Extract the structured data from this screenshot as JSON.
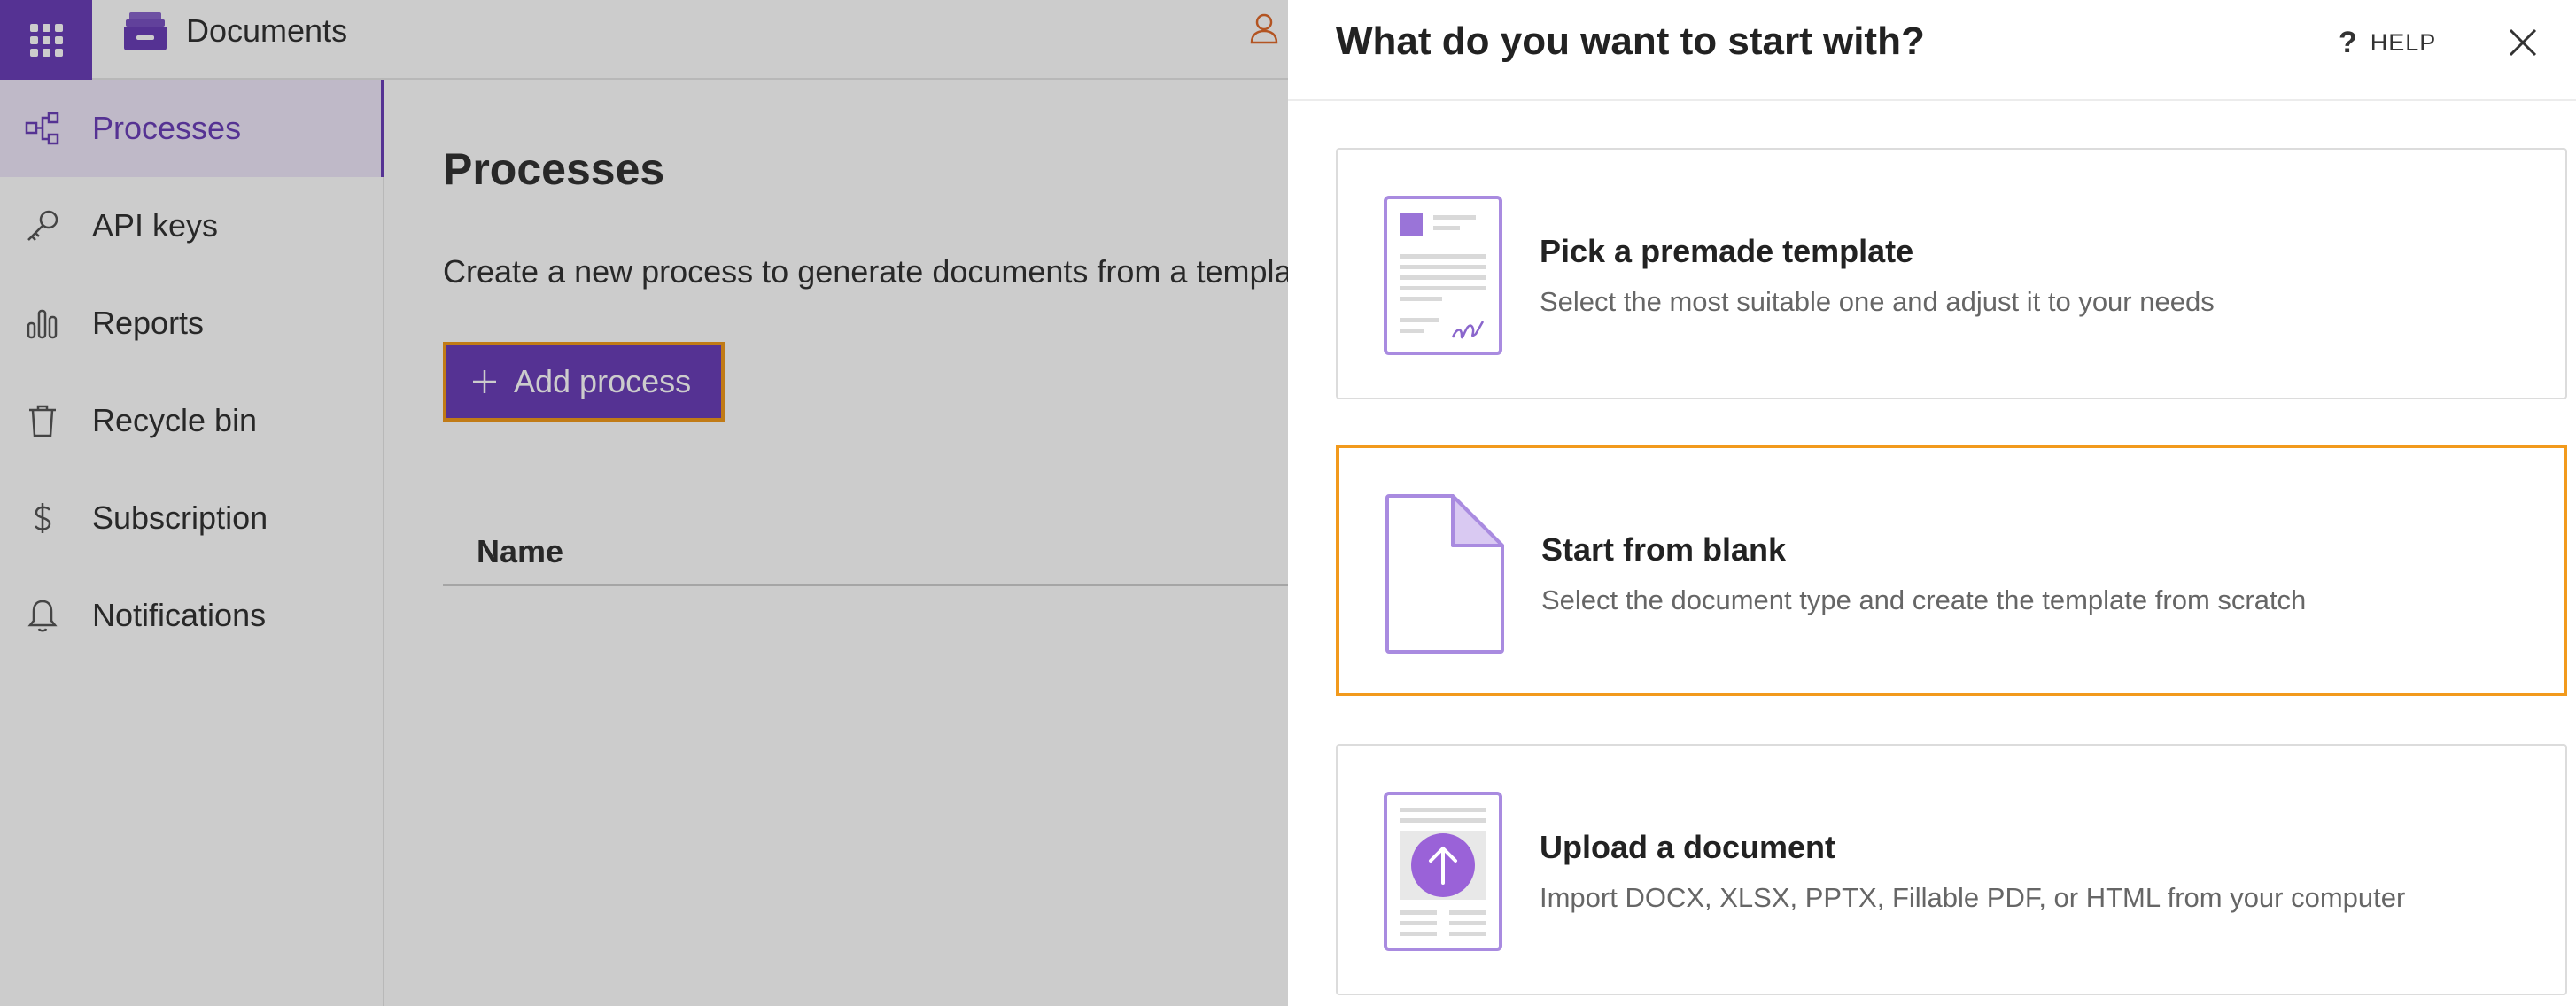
{
  "app": {
    "title": "Documents"
  },
  "sidebar": {
    "items": [
      {
        "label": "Processes",
        "icon": "flow-icon",
        "active": true
      },
      {
        "label": "API keys",
        "icon": "key-icon",
        "active": false
      },
      {
        "label": "Reports",
        "icon": "bar-chart-icon",
        "active": false
      },
      {
        "label": "Recycle bin",
        "icon": "trash-icon",
        "active": false
      },
      {
        "label": "Subscription",
        "icon": "dollar-icon",
        "active": false
      },
      {
        "label": "Notifications",
        "icon": "bell-icon",
        "active": false
      }
    ]
  },
  "main": {
    "title": "Processes",
    "description": "Create a new process to generate documents from a templa",
    "add_button": "Add process",
    "table": {
      "columns": [
        "Name"
      ]
    }
  },
  "drawer": {
    "title": "What do you want to start with?",
    "help": "HELP",
    "options": [
      {
        "title": "Pick a premade template",
        "description": "Select the most suitable one and adjust it to your needs",
        "icon": "template-document-icon",
        "selected": false
      },
      {
        "title": "Start from blank",
        "description": "Select the document type and create the template from scratch",
        "icon": "blank-document-icon",
        "selected": true
      },
      {
        "title": "Upload a document",
        "description": "Import DOCX, XLSX, PPTX, Fillable PDF, or HTML from your computer",
        "icon": "upload-document-icon",
        "selected": false
      }
    ]
  },
  "colors": {
    "accent": "#6b3fb8",
    "accent_light": "#efe8fa",
    "highlight": "#f29a1c",
    "icon_light": "#d9c9f2"
  }
}
